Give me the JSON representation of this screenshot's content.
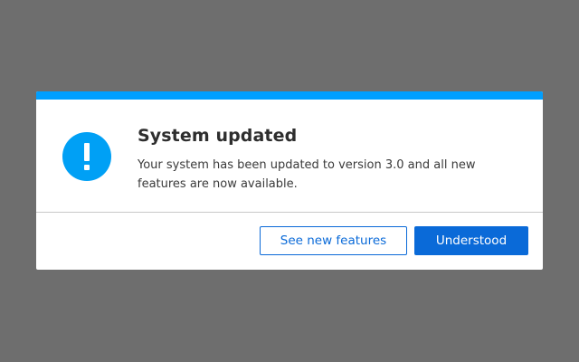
{
  "dialog": {
    "title": "System updated",
    "message": "Your system has been updated to version 3.0 and all new features are now available.",
    "icon": "exclamation-icon",
    "accent_color": "#009fff",
    "buttons": {
      "secondary_label": "See new features",
      "primary_label": "Understood"
    }
  }
}
